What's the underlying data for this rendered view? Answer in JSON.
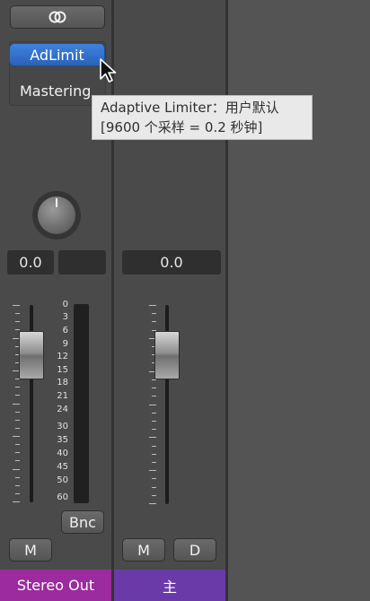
{
  "strip1": {
    "link_icon": "link-circles-icon",
    "plugin_label": "AdLimit",
    "insert_text": "Mastering",
    "pan_value": "0.0",
    "volume_value": "0.0",
    "scale": [
      "0",
      "3",
      "6",
      "9",
      "12",
      "15",
      "18",
      "21",
      "24",
      "30",
      "35",
      "40",
      "45",
      "50",
      "60"
    ],
    "bnc_label": "Bnc",
    "mute_label": "M",
    "name": "Stereo Out",
    "name_color": "#9b2b9e"
  },
  "strip2": {
    "volume_value": "0.0",
    "mute_label": "M",
    "dim_label": "D",
    "name": "主",
    "name_color": "#6a3aa8"
  },
  "tooltip": {
    "line1": "Adaptive Limiter：用户默认",
    "line2": "[9600 个采样 = 0.2 秒钟]"
  }
}
